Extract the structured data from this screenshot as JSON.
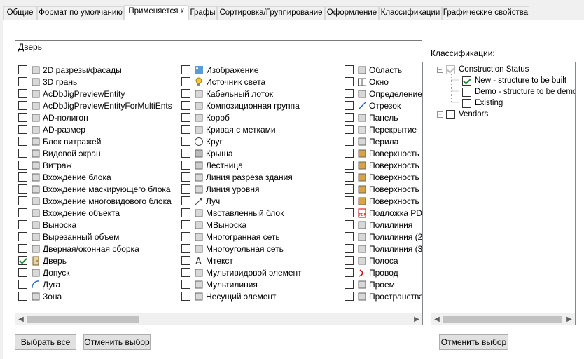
{
  "tabs": [
    {
      "label": "Общие"
    },
    {
      "label": "Формат по умолчанию"
    },
    {
      "label": "Применяется к"
    },
    {
      "label": "Графы"
    },
    {
      "label": "Сортировка/Группирование"
    },
    {
      "label": "Оформление"
    },
    {
      "label": "Классификации"
    },
    {
      "label": "Графические свойства"
    }
  ],
  "active_tab": "Применяется к",
  "name_field": {
    "value": "Дверь"
  },
  "classifications_label": "Классификации:",
  "objects": {
    "col1": [
      {
        "label": "2D разрезы/фасады",
        "checked": false,
        "icon": "elevation-icon"
      },
      {
        "label": "3D грань",
        "checked": false,
        "icon": "face-3d-icon"
      },
      {
        "label": "AcDbJigPreviewEntity",
        "checked": false,
        "icon": "jig-icon"
      },
      {
        "label": "AcDbJigPreviewEntityForMultiEnts",
        "checked": false,
        "icon": "jig-icon"
      },
      {
        "label": "AD-полигон",
        "checked": false,
        "icon": "polygon-icon"
      },
      {
        "label": "AD-размер",
        "checked": false,
        "icon": "dimension-icon"
      },
      {
        "label": "Блок витражей",
        "checked": false,
        "icon": "curtain-block-icon"
      },
      {
        "label": "Видовой экран",
        "checked": false,
        "icon": "viewport-icon"
      },
      {
        "label": "Витраж",
        "checked": false,
        "icon": "curtain-wall-icon"
      },
      {
        "label": "Вхождение блока",
        "checked": false,
        "icon": "block-ref-icon"
      },
      {
        "label": "Вхождение маскирующего блока",
        "checked": false,
        "icon": "mask-block-icon"
      },
      {
        "label": "Вхождение многовидового блока",
        "checked": false,
        "icon": "multiview-block-icon"
      },
      {
        "label": "Вхождение объекта",
        "checked": false,
        "icon": "object-ref-icon"
      },
      {
        "label": "Выноска",
        "checked": false,
        "icon": "leader-icon"
      },
      {
        "label": "Вырезанный объем",
        "checked": false,
        "icon": "cut-volume-icon"
      },
      {
        "label": "Дверная/оконная сборка",
        "checked": false,
        "icon": "door-window-assembly-icon"
      },
      {
        "label": "Дверь",
        "checked": true,
        "icon": "door-icon"
      },
      {
        "label": "Допуск",
        "checked": false,
        "icon": "tolerance-icon"
      },
      {
        "label": "Дуга",
        "checked": false,
        "icon": "arc-icon"
      },
      {
        "label": "Зона",
        "checked": false,
        "icon": "zone-icon"
      }
    ],
    "col2": [
      {
        "label": "Изображение",
        "checked": false,
        "icon": "image-icon"
      },
      {
        "label": "Источник света",
        "checked": false,
        "icon": "light-icon"
      },
      {
        "label": "Кабельный лоток",
        "checked": false,
        "icon": "cable-tray-icon"
      },
      {
        "label": "Композиционная группа",
        "checked": false,
        "icon": "group-icon"
      },
      {
        "label": "Короб",
        "checked": false,
        "icon": "box-icon"
      },
      {
        "label": "Кривая с метками",
        "checked": false,
        "icon": "labeled-curve-icon"
      },
      {
        "label": "Круг",
        "checked": false,
        "icon": "circle-icon"
      },
      {
        "label": "Крыша",
        "checked": false,
        "icon": "roof-icon"
      },
      {
        "label": "Лестница",
        "checked": false,
        "icon": "stair-icon"
      },
      {
        "label": "Линия разреза здания",
        "checked": false,
        "icon": "section-line-icon"
      },
      {
        "label": "Линия уровня",
        "checked": false,
        "icon": "level-line-icon"
      },
      {
        "label": "Луч",
        "checked": false,
        "icon": "ray-icon"
      },
      {
        "label": "Мвставленный блок",
        "checked": false,
        "icon": "minsert-icon"
      },
      {
        "label": "МВыноска",
        "checked": false,
        "icon": "mleader-icon"
      },
      {
        "label": "Многогранная сеть",
        "checked": false,
        "icon": "polyface-mesh-icon"
      },
      {
        "label": "Многоугольная сеть",
        "checked": false,
        "icon": "polygon-mesh-icon"
      },
      {
        "label": "Мтекст",
        "checked": false,
        "icon": "mtext-icon"
      },
      {
        "label": "Мультивидовой элемент",
        "checked": false,
        "icon": "multiview-element-icon"
      },
      {
        "label": "Мультилиния",
        "checked": false,
        "icon": "mline-icon"
      },
      {
        "label": "Несущий элемент",
        "checked": false,
        "icon": "structural-member-icon"
      }
    ],
    "col3": [
      {
        "label": "Область",
        "checked": false,
        "icon": "region-icon"
      },
      {
        "label": "Окно",
        "checked": false,
        "icon": "window-icon"
      },
      {
        "label": "Определение",
        "checked": false,
        "icon": "definition-icon"
      },
      {
        "label": "Отрезок",
        "checked": false,
        "icon": "line-icon"
      },
      {
        "label": "Панель",
        "checked": false,
        "icon": "panel-icon"
      },
      {
        "label": "Перекрытие",
        "checked": false,
        "icon": "slab-icon"
      },
      {
        "label": "Перила",
        "checked": false,
        "icon": "railing-icon"
      },
      {
        "label": "Поверхность",
        "checked": false,
        "icon": "surface-icon"
      },
      {
        "label": "Поверхность",
        "checked": false,
        "icon": "surface-extruded-icon"
      },
      {
        "label": "Поверхность",
        "checked": false,
        "icon": "surface-revolved-icon"
      },
      {
        "label": "Поверхность",
        "checked": false,
        "icon": "surface-planar-icon"
      },
      {
        "label": "Поверхность",
        "checked": false,
        "icon": "surface-swept-icon"
      },
      {
        "label": "Подложка PD",
        "checked": false,
        "icon": "pdf-underlay-icon"
      },
      {
        "label": "Полилиния",
        "checked": false,
        "icon": "polyline-icon"
      },
      {
        "label": "Полилиния (2",
        "checked": false,
        "icon": "polyline-2d-icon"
      },
      {
        "label": "Полилиния (3",
        "checked": false,
        "icon": "polyline-3d-icon"
      },
      {
        "label": "Полоса",
        "checked": false,
        "icon": "strip-icon"
      },
      {
        "label": "Провод",
        "checked": false,
        "icon": "wire-icon"
      },
      {
        "label": "Проем",
        "checked": false,
        "icon": "opening-icon"
      },
      {
        "label": "Пространства",
        "checked": false,
        "icon": "space-icon"
      }
    ]
  },
  "tree": [
    {
      "label": "Construction Status",
      "checked": true,
      "disabled": true,
      "expander": "−",
      "level": 0
    },
    {
      "label": "New - structure to be built",
      "checked": true,
      "disabled": false,
      "level": 1
    },
    {
      "label": "Demo - structure to be demolis",
      "checked": false,
      "disabled": false,
      "level": 1
    },
    {
      "label": "Existing",
      "checked": false,
      "disabled": false,
      "level": 1
    },
    {
      "label": "Vendors",
      "checked": false,
      "disabled": false,
      "expander": "+",
      "level": 0
    }
  ],
  "buttons": {
    "select_all": "Выбрать все",
    "deselect_left": "Отменить выбор",
    "deselect_right": "Отменить выбор"
  },
  "colors": {
    "check": "#1f8a2e",
    "tab_border": "#d9d9d9",
    "list_border": "#828790"
  }
}
